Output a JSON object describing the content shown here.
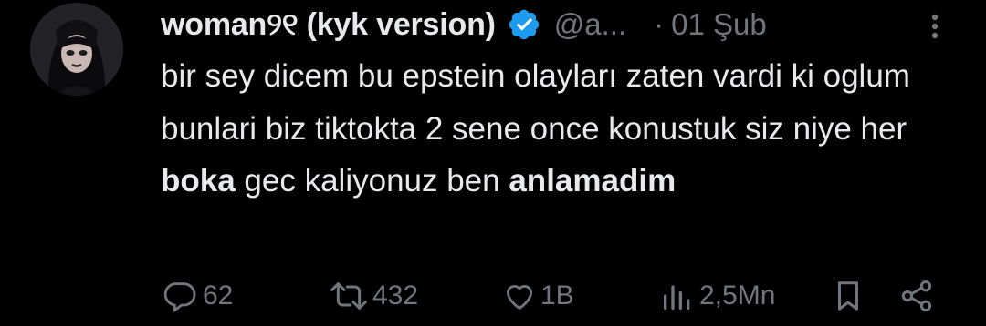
{
  "tweet": {
    "author": {
      "display_name": "woman୨୧ (kyk version)",
      "handle": "@a...",
      "verified": true
    },
    "date_separator": "·",
    "date": "01 Şub",
    "text_parts": [
      "bir sey dicem bu epstein olayları zaten vardi ki oglum bunlari biz tiktokta 2 sene once konustuk siz niye her ",
      "boka",
      " gec kaliyonuz ben ",
      "anlamadim"
    ],
    "actions": {
      "replies": "62",
      "reposts": "432",
      "likes": "1B",
      "views": "2,5Mn"
    }
  },
  "icons": {
    "verified": "verified-badge-icon",
    "more": "more-options-icon",
    "reply": "reply-icon",
    "repost": "repost-icon",
    "like": "heart-icon",
    "views": "analytics-icon",
    "bookmark": "bookmark-icon",
    "share": "share-icon"
  },
  "colors": {
    "background": "#000000",
    "text": "#e7e9ea",
    "secondary": "#71767b",
    "verified": "#1d9bf0"
  }
}
